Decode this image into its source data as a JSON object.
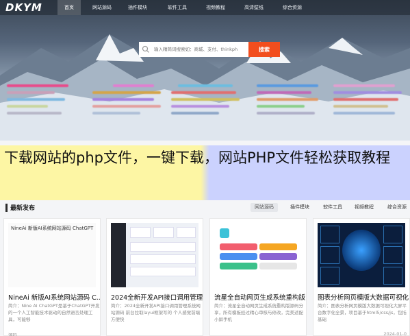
{
  "logo": "DKYM",
  "nav": [
    "首页",
    "网站源码",
    "插件模块",
    "软件工具",
    "视频教程",
    "高清壁纸",
    "综合资源"
  ],
  "search": {
    "placeholder": "输入精简词搜索如：商城、支付、thinkph",
    "button": "搜索"
  },
  "overlay_title": "下载网站的php文件，一键下载，网站PHP文件轻松获取教程",
  "section": {
    "title": "最新发布",
    "tabs": [
      "网站源码",
      "插件模块",
      "软件工具",
      "视频教程",
      "综合资源"
    ]
  },
  "cards": [
    {
      "thumb_title": "NineAi 新版AI系统网站源码 ChatGPT",
      "title": "NineAi 新版AI系统网站源码 C...",
      "desc": "简介：Nine AI ChatGPT是基于ChatGPT开发的一个人工智能技术驱动的自然语言处理工具，可能够",
      "foot": "源码"
    },
    {
      "title": "2024全新开发API接口调用管理...",
      "desc": "简介：2024全新开发API接口调用管理系统网站源码 前台拉取layui框架写的 个人感觉前端方便快",
      "foot": ""
    },
    {
      "title": "流星全自动网页生成系统重构版...",
      "desc": "简介：流星全自动网页生成系统重构版源码分享，所有模板经过精心审核与修改，完美适配小屏手机",
      "foot": ""
    },
    {
      "title": "图表分析网页模版大数据可视化...",
      "desc": "简介：图表分析网页模版大数据可视化大屏平台数字化全景，项目基于html5/css/js，包括基础",
      "foot": "",
      "date": "2024-01-0"
    }
  ],
  "colors": {
    "search_button": "#f24e1e",
    "overlay_left": "#fff696",
    "overlay_right": "#c4ccff"
  }
}
